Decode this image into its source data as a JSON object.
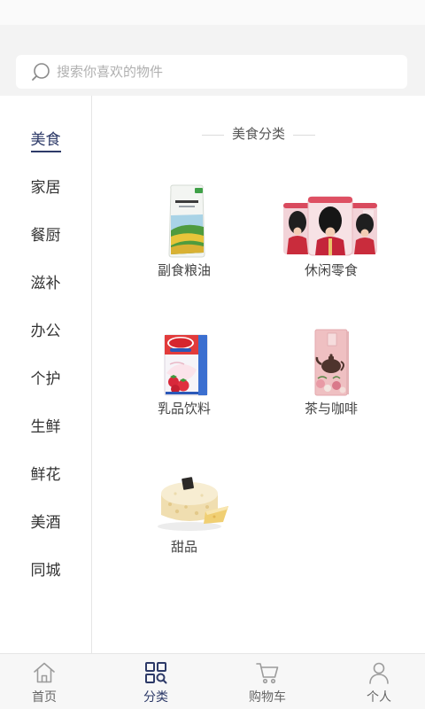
{
  "search": {
    "placeholder": "搜索你喜欢的物件",
    "icon": "search-icon"
  },
  "sidebar": {
    "selected_index": 0,
    "items": [
      {
        "label": "美食"
      },
      {
        "label": "家居"
      },
      {
        "label": "餐厨"
      },
      {
        "label": "滋补"
      },
      {
        "label": "办公"
      },
      {
        "label": "个护"
      },
      {
        "label": "生鲜"
      },
      {
        "label": "鲜花"
      },
      {
        "label": "美酒"
      },
      {
        "label": "同城"
      }
    ]
  },
  "main": {
    "section_title": "美食分类",
    "categories": [
      {
        "label": "副食粮油",
        "image": "rice-bag-image"
      },
      {
        "label": "休闲零食",
        "image": "snack-tins-image"
      },
      {
        "label": "乳品饮料",
        "image": "milk-carton-image"
      },
      {
        "label": "茶与咖啡",
        "image": "tea-box-image"
      },
      {
        "label": "甜品",
        "image": "cake-image"
      }
    ]
  },
  "tabbar": {
    "selected_index": 1,
    "tabs": [
      {
        "label": "首页",
        "icon": "home-icon"
      },
      {
        "label": "分类",
        "icon": "category-icon"
      },
      {
        "label": "购物车",
        "icon": "cart-icon"
      },
      {
        "label": "个人",
        "icon": "user-icon"
      }
    ]
  },
  "colors": {
    "accent": "#2d3a68",
    "text": "#333333",
    "muted": "#999999",
    "header_bg": "#f3f3f3",
    "tabbar_bg": "#f7f7f7"
  }
}
